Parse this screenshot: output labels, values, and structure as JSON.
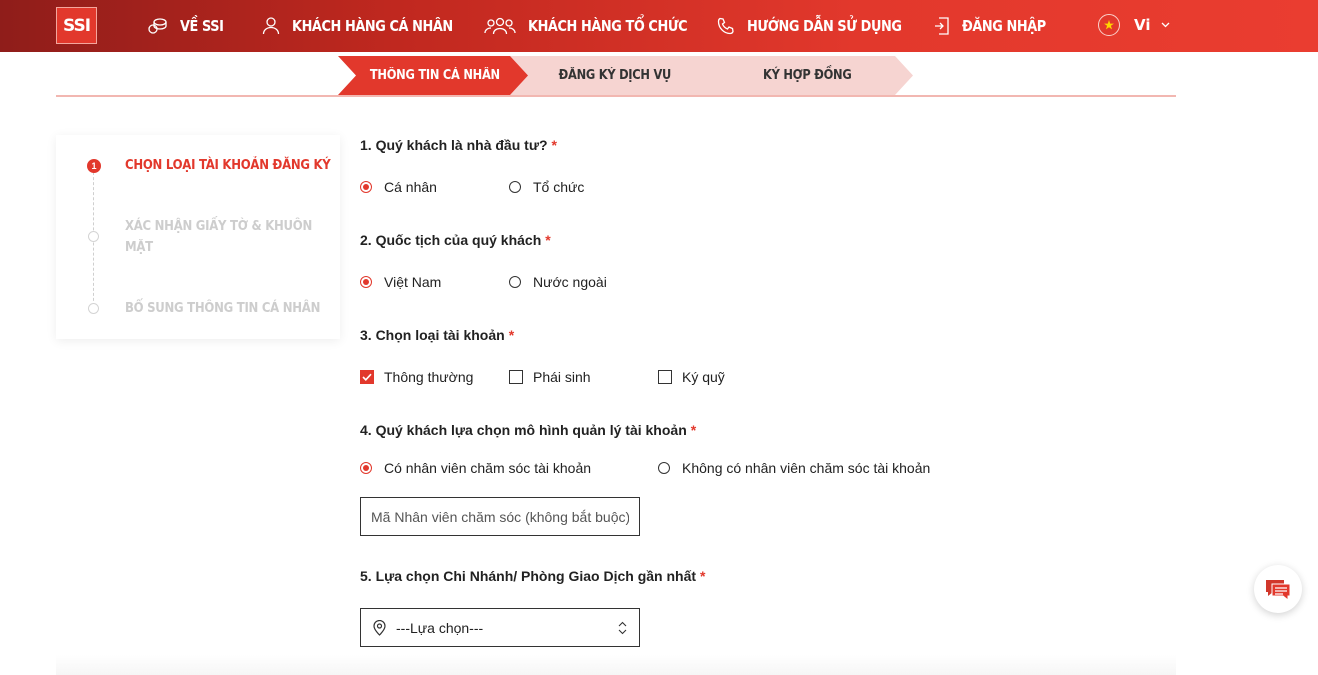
{
  "nav": {
    "logo": "SSI",
    "items": [
      {
        "label": "VỀ SSI",
        "icon": "coins-icon"
      },
      {
        "label": "KHÁCH HÀNG CÁ NHÂN",
        "icon": "user-icon"
      },
      {
        "label": "KHÁCH HÀNG TỔ CHỨC",
        "icon": "users-group-icon"
      },
      {
        "label": "HƯỚNG DẪN SỬ DỤNG",
        "icon": "phone-icon"
      },
      {
        "label": "ĐĂNG NHẬP",
        "icon": "login-icon"
      }
    ],
    "language": "Vi"
  },
  "steps": [
    {
      "label": "THÔNG TIN CÁ NHÂN",
      "active": true
    },
    {
      "label": "ĐĂNG KÝ DỊCH VỤ",
      "active": false
    },
    {
      "label": "KÝ HỢP ĐỒNG",
      "active": false
    }
  ],
  "sidebar": {
    "active_number": "1",
    "items": [
      {
        "label": "CHỌN LOẠI TÀI KHOẢN ĐĂNG KÝ",
        "active": true
      },
      {
        "label_line1": "XÁC NHẬN GIẤY TỜ & KHUÔN",
        "label_line2": "MẶT",
        "active": false
      },
      {
        "label": "BỔ SUNG THÔNG TIN CÁ NHÂN",
        "active": false
      }
    ]
  },
  "form": {
    "required_mark": "*",
    "q1": {
      "label": "1. Quý khách là nhà đầu tư?",
      "options": [
        "Cá nhân",
        "Tổ chức"
      ],
      "selected": "Cá nhân"
    },
    "q2": {
      "label": "2. Quốc tịch của quý khách",
      "options": [
        "Việt Nam",
        "Nước ngoài"
      ],
      "selected": "Việt Nam"
    },
    "q3": {
      "label": "3. Chọn loại tài khoản",
      "options": [
        "Thông thường",
        "Phái sinh",
        "Ký quỹ"
      ],
      "checked": [
        "Thông thường"
      ]
    },
    "q4": {
      "label": "4. Quý khách lựa chọn mô hình quản lý tài khoản",
      "options": [
        "Có nhân viên chăm sóc tài khoản",
        "Không có nhân viên chăm sóc tài khoản"
      ],
      "selected": "Có nhân viên chăm sóc tài khoản",
      "input_placeholder": "Mã Nhân viên chăm sóc (không bắt buộc)",
      "input_value": ""
    },
    "q5": {
      "label": "5. Lựa chọn Chi Nhánh/ Phòng Giao Dịch gần nhất",
      "select_value": "---Lựa chọn---"
    }
  },
  "colors": {
    "brand": "#e2382c",
    "step_inactive": "#f6d4d1"
  }
}
